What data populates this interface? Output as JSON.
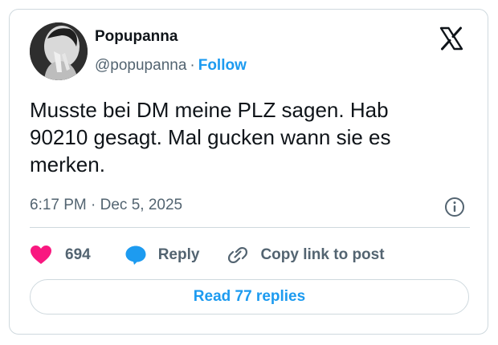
{
  "author": {
    "display_name": "Popupanna",
    "handle": "@popupanna",
    "separator": "·",
    "follow_label": "Follow"
  },
  "tweet": {
    "text": "Musste bei DM meine PLZ sagen. Hab\n90210 gesagt. Mal gucken wann sie es\nmerken.",
    "timestamp": "6:17 PM · Dec 5, 2025"
  },
  "actions": {
    "like_count": "694",
    "reply_label": "Reply",
    "copy_link_label": "Copy link to post"
  },
  "read_replies_label": "Read 77 replies",
  "colors": {
    "like": "#f91880",
    "accent": "#1d9bf0",
    "text": "#0f1419",
    "secondary": "#536471",
    "border": "#cfd9de"
  },
  "icons": [
    "x-logo-icon",
    "info-icon",
    "heart-icon",
    "reply-bubble-icon",
    "link-icon"
  ]
}
